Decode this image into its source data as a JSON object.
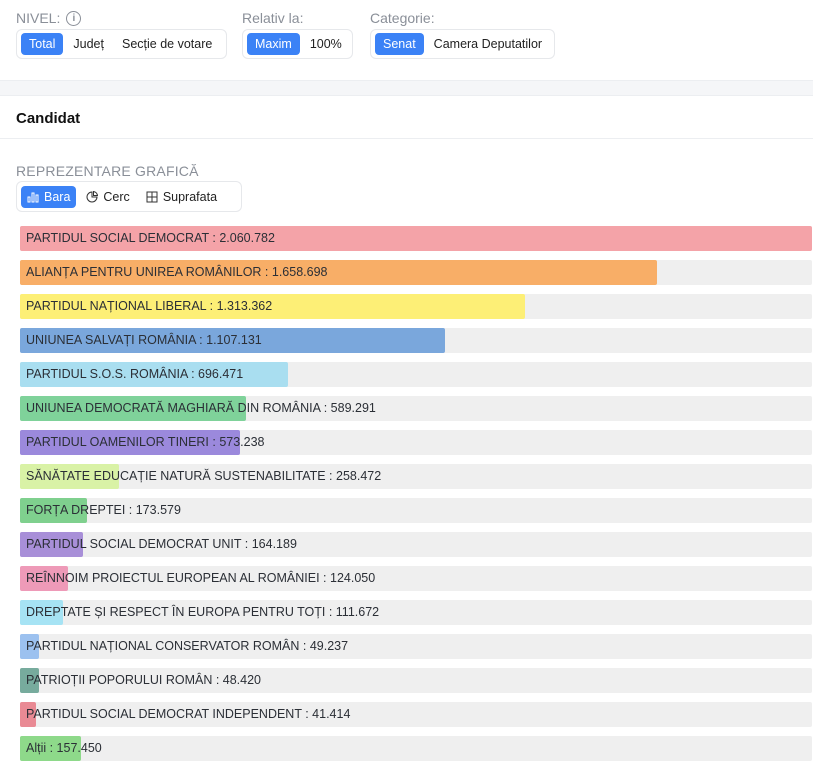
{
  "filters": {
    "nivel": {
      "label": "NIVEL:",
      "options": [
        "Total",
        "Județ",
        "Secție de votare"
      ],
      "active": 0
    },
    "relativ": {
      "label": "Relativ la:",
      "options": [
        "Maxim",
        "100%"
      ],
      "active": 0
    },
    "categorie": {
      "label": "Categorie:",
      "options": [
        "Senat",
        "Camera Deputatilor"
      ],
      "active": 0
    }
  },
  "section": {
    "title": "Candidat"
  },
  "representation": {
    "label": "REPREZENTARE GRAFICĂ",
    "options": [
      {
        "label": "Bara",
        "icon": "bar-chart-icon"
      },
      {
        "label": "Cerc",
        "icon": "pie-chart-icon"
      },
      {
        "label": "Suprafata",
        "icon": "area-chart-icon"
      }
    ],
    "active": 0
  },
  "chart_data": {
    "type": "bar",
    "orientation": "horizontal",
    "max": 2060782,
    "items": [
      {
        "label": "PARTIDUL SOCIAL DEMOCRAT : 2.060.782",
        "name": "PARTIDUL SOCIAL DEMOCRAT",
        "value": 2060782,
        "color": "#f4a3a8"
      },
      {
        "label": "ALIANȚA PENTRU UNIREA ROMÂNILOR : 1.658.698",
        "name": "ALIANȚA PENTRU UNIREA ROMÂNILOR",
        "value": 1658698,
        "color": "#f8ae67"
      },
      {
        "label": "PARTIDUL NAȚIONAL LIBERAL : 1.313.362",
        "name": "PARTIDUL NAȚIONAL LIBERAL",
        "value": 1313362,
        "color": "#fdef76"
      },
      {
        "label": "UNIUNEA SALVAȚI ROMÂNIA : 1.107.131",
        "name": "UNIUNEA SALVAȚI ROMÂNIA",
        "value": 1107131,
        "color": "#7aa7dc"
      },
      {
        "label": "PARTIDUL S.O.S. ROMÂNIA : 696.471",
        "name": "PARTIDUL S.O.S. ROMÂNIA",
        "value": 696471,
        "color": "#a9def0"
      },
      {
        "label": "UNIUNEA DEMOCRATĂ MAGHIARĂ DIN ROMÂNIA : 589.291",
        "name": "UNIUNEA DEMOCRATĂ MAGHIARĂ DIN ROMÂNIA",
        "value": 589291,
        "color": "#7fd29a"
      },
      {
        "label": "PARTIDUL OAMENILOR TINERI : 573.238",
        "name": "PARTIDUL OAMENILOR TINERI",
        "value": 573238,
        "color": "#9b89dc"
      },
      {
        "label": "SĂNĂTATE EDUCAȚIE NATURĂ SUSTENABILITATE : 258.472",
        "name": "SĂNĂTATE EDUCAȚIE NATURĂ SUSTENABILITATE",
        "value": 258472,
        "color": "#d9f2a6"
      },
      {
        "label": "FORȚA DREPTEI : 173.579",
        "name": "FORȚA DREPTEI",
        "value": 173579,
        "color": "#7fd08e"
      },
      {
        "label": "PARTIDUL SOCIAL DEMOCRAT UNIT : 164.189",
        "name": "PARTIDUL SOCIAL DEMOCRAT UNIT",
        "value": 164189,
        "color": "#a88fd8"
      },
      {
        "label": "REÎNNOIM PROIECTUL EUROPEAN AL ROMÂNIEI : 124.050",
        "name": "REÎNNOIM PROIECTUL EUROPEAN AL ROMÂNIEI",
        "value": 124050,
        "color": "#ee9ab8"
      },
      {
        "label": "DREPTATE ȘI RESPECT ÎN EUROPA PENTRU TOȚI : 111.672",
        "name": "DREPTATE ȘI RESPECT ÎN EUROPA PENTRU TOȚI",
        "value": 111672,
        "color": "#a6e3f4"
      },
      {
        "label": "PARTIDUL NAȚIONAL CONSERVATOR ROMÂN : 49.237",
        "name": "PARTIDUL NAȚIONAL CONSERVATOR ROMÂN",
        "value": 49237,
        "color": "#9cc1ef"
      },
      {
        "label": "PATRIOȚII POPORULUI ROMÂN : 48.420",
        "name": "PATRIOȚII POPORULUI ROMÂN",
        "value": 48420,
        "color": "#77ab9d"
      },
      {
        "label": "PARTIDUL SOCIAL DEMOCRAT INDEPENDENT : 41.414",
        "name": "PARTIDUL SOCIAL DEMOCRAT INDEPENDENT",
        "value": 41414,
        "color": "#e98a94"
      },
      {
        "label": "Alții : 157.450",
        "name": "Alții",
        "value": 157450,
        "color": "#8ed98a"
      }
    ]
  }
}
